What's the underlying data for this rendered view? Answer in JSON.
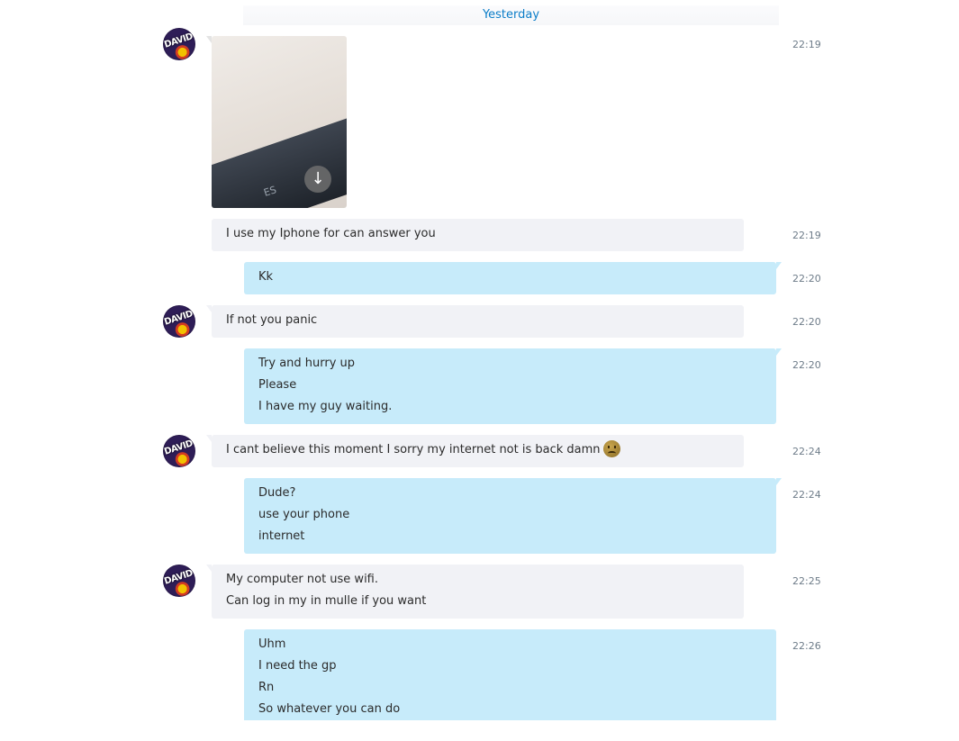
{
  "date_divider": "Yesterday",
  "contact": {
    "avatar_text": "DAVID"
  },
  "photo": {
    "key_label": "ES",
    "download_icon": "download-icon"
  },
  "messages": [
    {
      "direction": "in",
      "kind": "photo",
      "time": "22:19"
    },
    {
      "direction": "in",
      "lines": [
        "I use my Iphone for can answer you"
      ],
      "time": "22:19"
    },
    {
      "direction": "out",
      "lines": [
        "Kk"
      ],
      "time": "22:20"
    },
    {
      "direction": "in",
      "lines": [
        "If not you panic"
      ],
      "time": "22:20"
    },
    {
      "direction": "out",
      "lines": [
        "Try and hurry up",
        "Please",
        "I have my guy waiting."
      ],
      "time": "22:20"
    },
    {
      "direction": "in",
      "lines": [
        "I cant believe this moment I sorry my internet not is back damn"
      ],
      "emoji": "sad-face-emoji",
      "time": "22:24"
    },
    {
      "direction": "out",
      "lines": [
        "Dude?",
        "use your phone",
        "internet"
      ],
      "time": "22:24"
    },
    {
      "direction": "in",
      "lines": [
        "My computer not use wifi.",
        "Can log in my in mulle if you want"
      ],
      "time": "22:25"
    },
    {
      "direction": "out",
      "lines": [
        "Uhm",
        "I need the gp",
        "Rn",
        "So whatever you can do"
      ],
      "time": "22:26"
    }
  ],
  "colors": {
    "incoming_bubble": "#f1f2f6",
    "outgoing_bubble": "#c7ebfa",
    "date_text": "#0b7dc8",
    "timestamp": "#6e7c89"
  }
}
